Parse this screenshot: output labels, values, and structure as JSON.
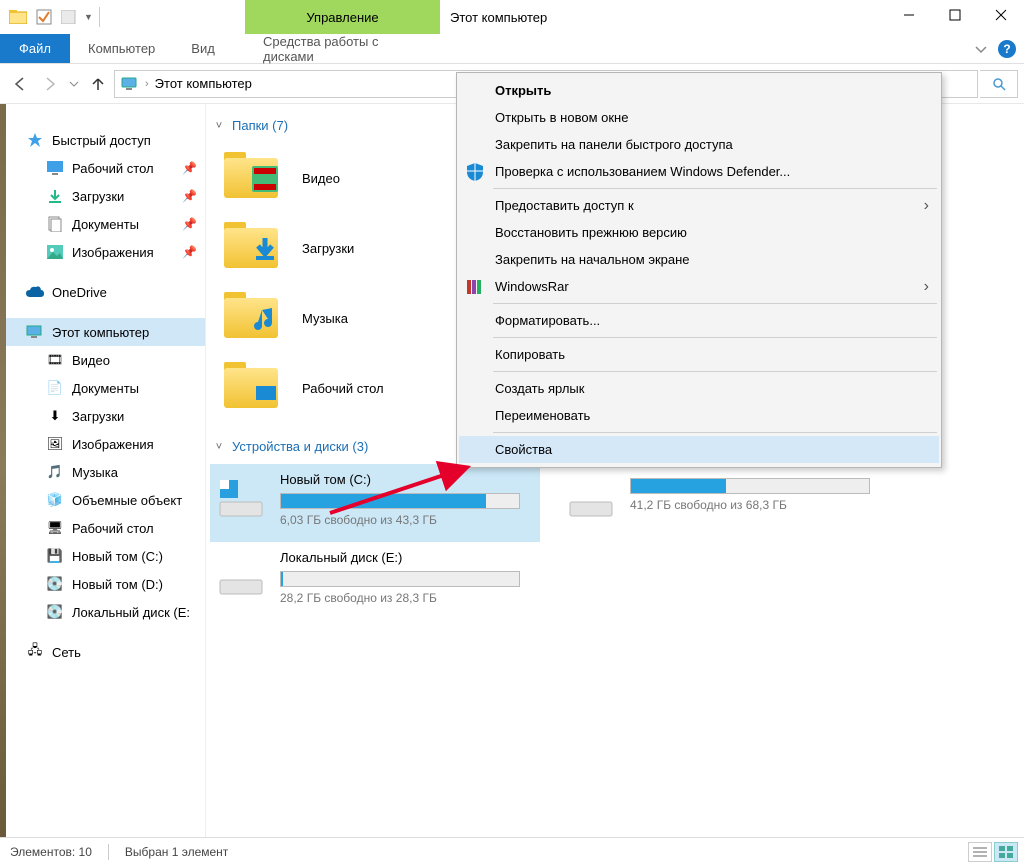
{
  "titlebar": {
    "title": "Этот компьютер",
    "ribbon_context_tab": "Управление"
  },
  "ribbon": {
    "file": "Файл",
    "computer": "Компьютер",
    "view": "Вид",
    "tools": "Средства работы с дисками"
  },
  "address": {
    "location": "Этот компьютер"
  },
  "nav": {
    "quick_access": "Быстрый доступ",
    "desktop": "Рабочий стол",
    "downloads": "Загрузки",
    "documents": "Документы",
    "pictures": "Изображения",
    "onedrive": "OneDrive",
    "this_pc": "Этот компьютер",
    "videos": "Видео",
    "documents2": "Документы",
    "downloads2": "Загрузки",
    "pictures2": "Изображения",
    "music": "Музыка",
    "objects3d": "Объемные объект",
    "desktop2": "Рабочий стол",
    "drive_c": "Новый том (C:)",
    "drive_d": "Новый том (D:)",
    "drive_e": "Локальный диск (E:",
    "network": "Сеть"
  },
  "content": {
    "folders_header": "Папки (7)",
    "folder_video": "Видео",
    "folder_downloads": "Загрузки",
    "folder_music": "Музыка",
    "folder_desktop": "Рабочий стол",
    "disks_header": "Устройства и диски (3)",
    "disks": [
      {
        "name": "Новый том (C:)",
        "info": "6,03 ГБ свободно из 43,3 ГБ",
        "fill": 86
      },
      {
        "name": "",
        "info": "41,2 ГБ свободно из 68,3 ГБ",
        "fill": 40
      },
      {
        "name": "Локальный диск (E:)",
        "info": "28,2 ГБ свободно из 28,3 ГБ",
        "fill": 1
      }
    ]
  },
  "context_menu": {
    "open": "Открыть",
    "open_new_window": "Открыть в новом окне",
    "pin_quick": "Закрепить на панели быстрого доступа",
    "defender": "Проверка с использованием Windows Defender...",
    "share_access": "Предоставить доступ к",
    "restore": "Восстановить прежнюю версию",
    "pin_start": "Закрепить на начальном экране",
    "winrar": "WindowsRar",
    "format": "Форматировать...",
    "copy": "Копировать",
    "shortcut": "Создать ярлык",
    "rename": "Переименовать",
    "properties": "Свойства"
  },
  "status": {
    "items": "Элементов: 10",
    "selected": "Выбран 1 элемент"
  }
}
